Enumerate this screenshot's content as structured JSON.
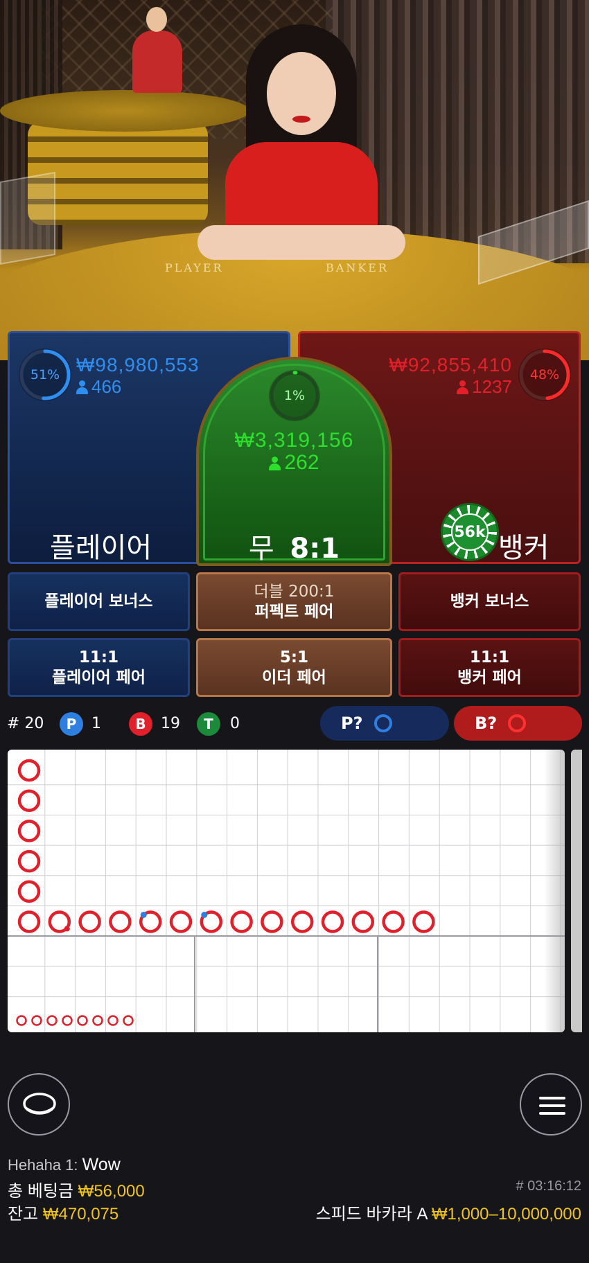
{
  "player": {
    "percent": "51%",
    "percent_value": 51,
    "amount": "₩98,980,553",
    "count": "466",
    "label": "플레이어"
  },
  "banker": {
    "percent": "48%",
    "percent_value": 48,
    "amount": "₩92,855,410",
    "count": "1237",
    "label": "뱅커",
    "chip": "56k"
  },
  "tie": {
    "percent": "1%",
    "percent_value": 1,
    "amount": "₩3,319,156",
    "count": "262",
    "label": "무",
    "payout": "8:1"
  },
  "table_labels": {
    "player": "PLAYER",
    "banker": "BANKER"
  },
  "side_bets": {
    "player_bonus": "플레이어 보너스",
    "perfect_pair_line1": "더블 200:1",
    "perfect_pair_line2": "퍼펙트 페어",
    "banker_bonus": "뱅커 보너스",
    "player_pair_odds": "11:1",
    "player_pair": "플레이어 페어",
    "either_pair_odds": "5:1",
    "either_pair": "이더 페어",
    "banker_pair_odds": "11:1",
    "banker_pair": "뱅커 페어"
  },
  "stats": {
    "rounds": "# 20",
    "p_badge": "P",
    "p_count": "1",
    "b_badge": "B",
    "b_count": "19",
    "t_badge": "T",
    "t_count": "0"
  },
  "predict": {
    "player": "P?",
    "banker": "B?"
  },
  "chat": {
    "user": "Hehaha 1:",
    "message": "Wow"
  },
  "footer": {
    "total_bet_label": "총 베팅금",
    "total_bet": "₩56,000",
    "balance_label": "잔고",
    "balance": "₩470,075",
    "round_id": "# 03:16:12",
    "table_name": "스피드 바카라 A",
    "limits": "₩1,000–10,000,000"
  },
  "colors": {
    "player_blue": "#2f7fe0",
    "banker_red": "#e0202a",
    "tie_green": "#22c422",
    "gold": "#f0c419"
  },
  "icons": [
    "chat-bubble-icon",
    "menu-icon",
    "person-icon"
  ]
}
